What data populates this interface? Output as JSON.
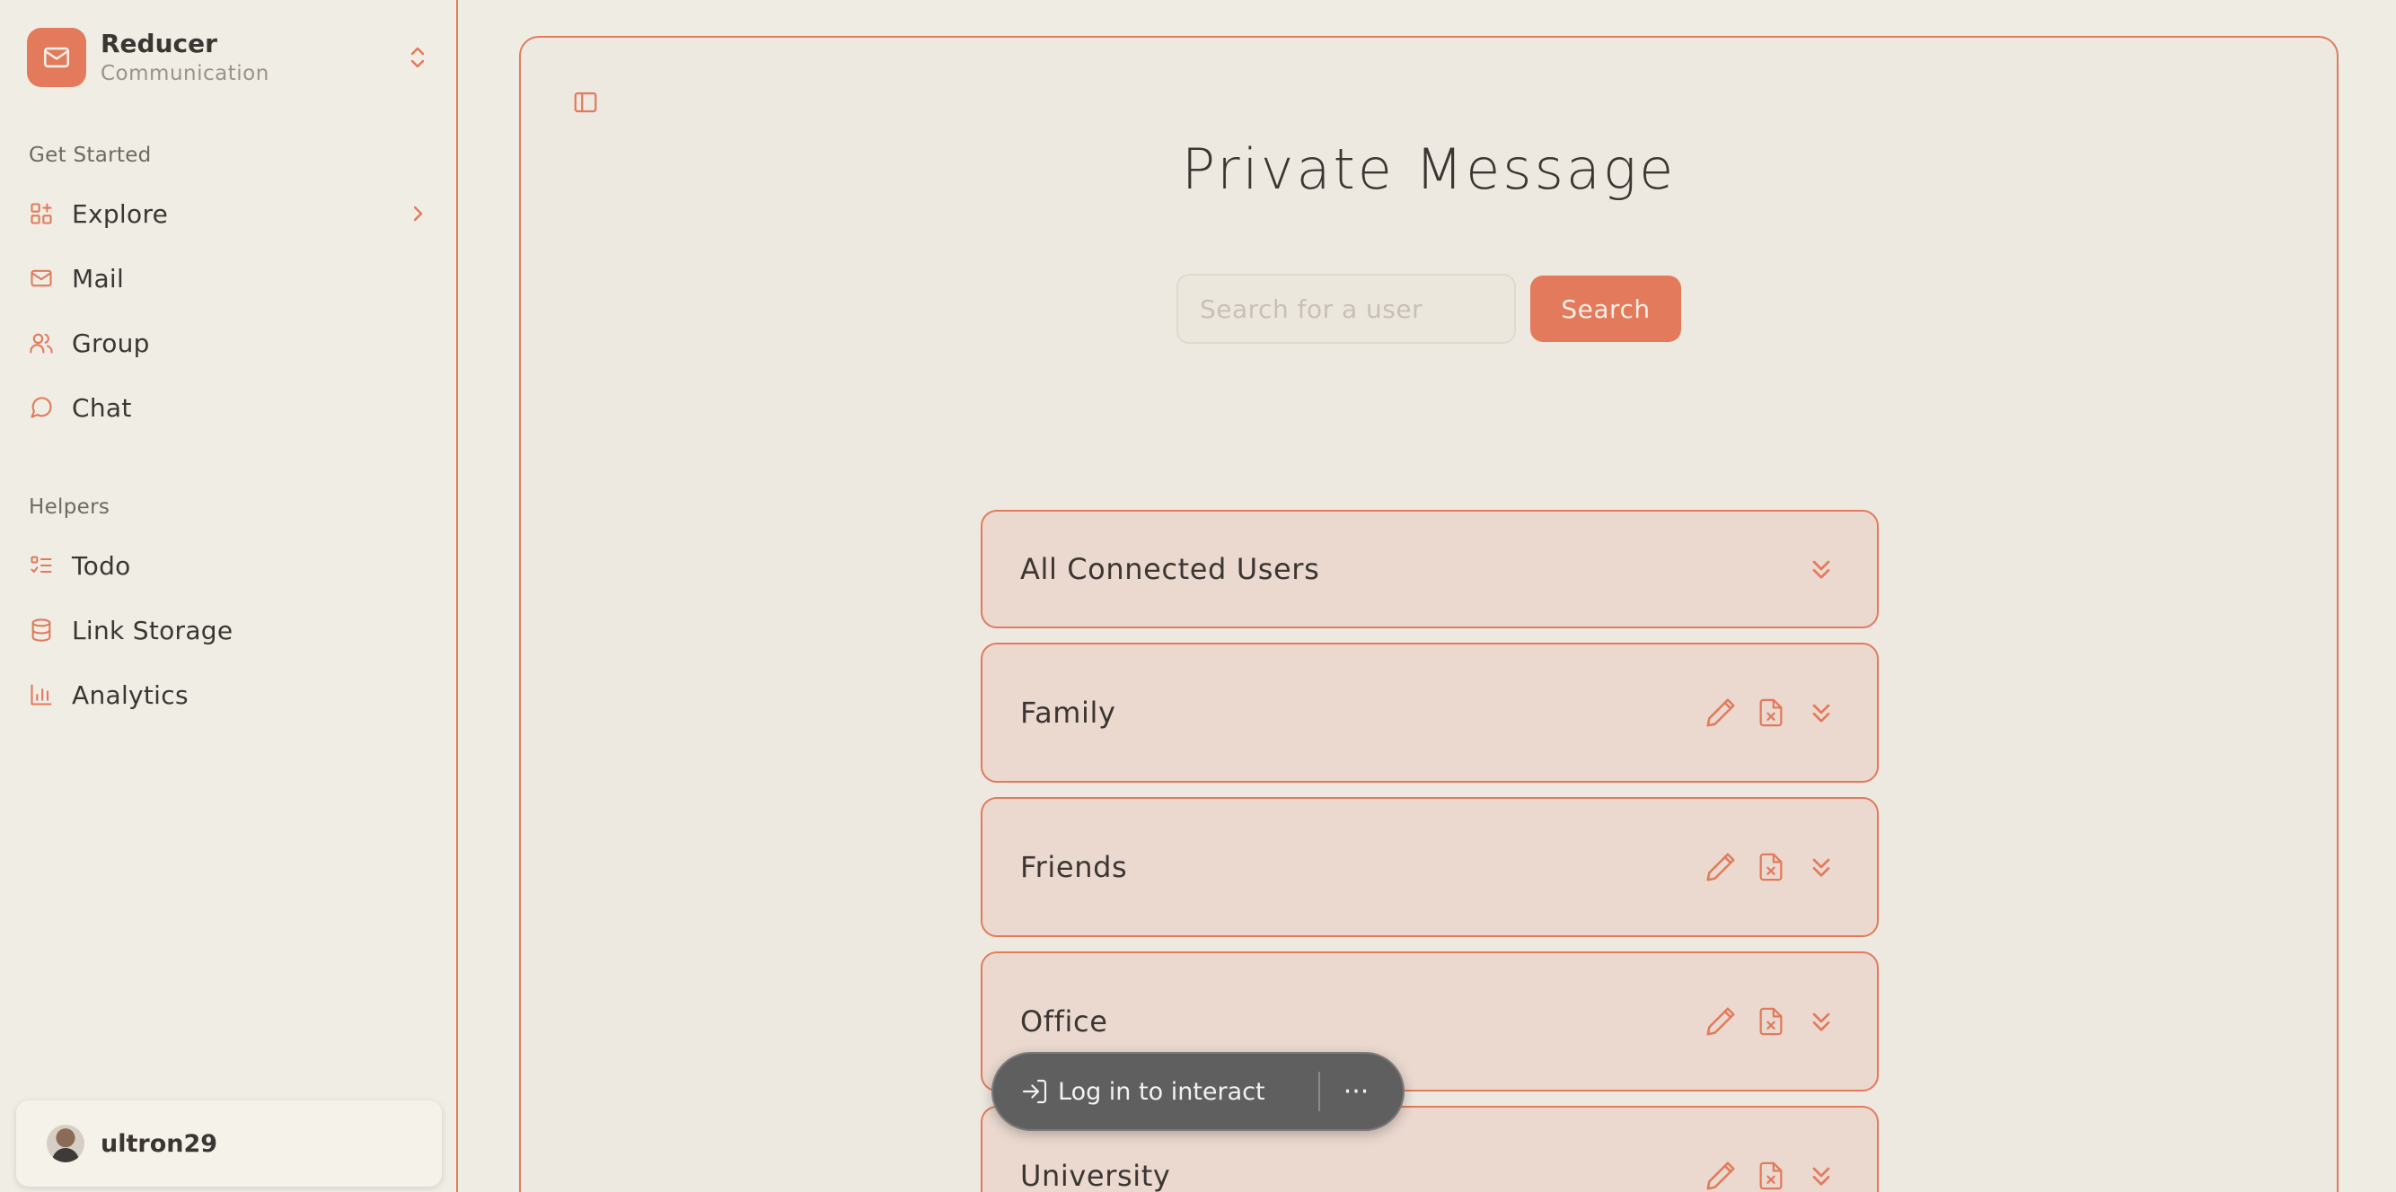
{
  "colors": {
    "accent": "#e27a5b",
    "panel": "#ede9e1",
    "card": "#ebd9cf",
    "text": "#3b3632"
  },
  "brand": {
    "name": "Reducer",
    "subtitle": "Communication",
    "logo_icon": "mail-icon",
    "switch_icon": "chevrons-up-down-icon"
  },
  "sidebar": {
    "sections": [
      {
        "label": "Get Started"
      },
      {
        "label": "Helpers"
      }
    ],
    "items": [
      {
        "label": "Explore",
        "icon": "grid-plus-icon",
        "has_chevron": true
      },
      {
        "label": "Mail",
        "icon": "mail-icon"
      },
      {
        "label": "Group",
        "icon": "users-icon"
      },
      {
        "label": "Chat",
        "icon": "message-circle-icon"
      },
      {
        "label": "Todo",
        "icon": "list-todo-icon"
      },
      {
        "label": "Link Storage",
        "icon": "database-icon"
      },
      {
        "label": "Analytics",
        "icon": "bar-chart-icon"
      }
    ],
    "user": {
      "name": "ultron29"
    }
  },
  "main": {
    "title": "Private Message",
    "search": {
      "placeholder": "Search for a user",
      "value": "",
      "button_label": "Search"
    },
    "groups": [
      {
        "name": "All Connected Users",
        "editable": false
      },
      {
        "name": "Family",
        "editable": true
      },
      {
        "name": "Friends",
        "editable": true
      },
      {
        "name": "Office",
        "editable": true
      },
      {
        "name": "University",
        "editable": true
      }
    ]
  },
  "toast": {
    "label": "Log in to interact",
    "more": "···"
  }
}
